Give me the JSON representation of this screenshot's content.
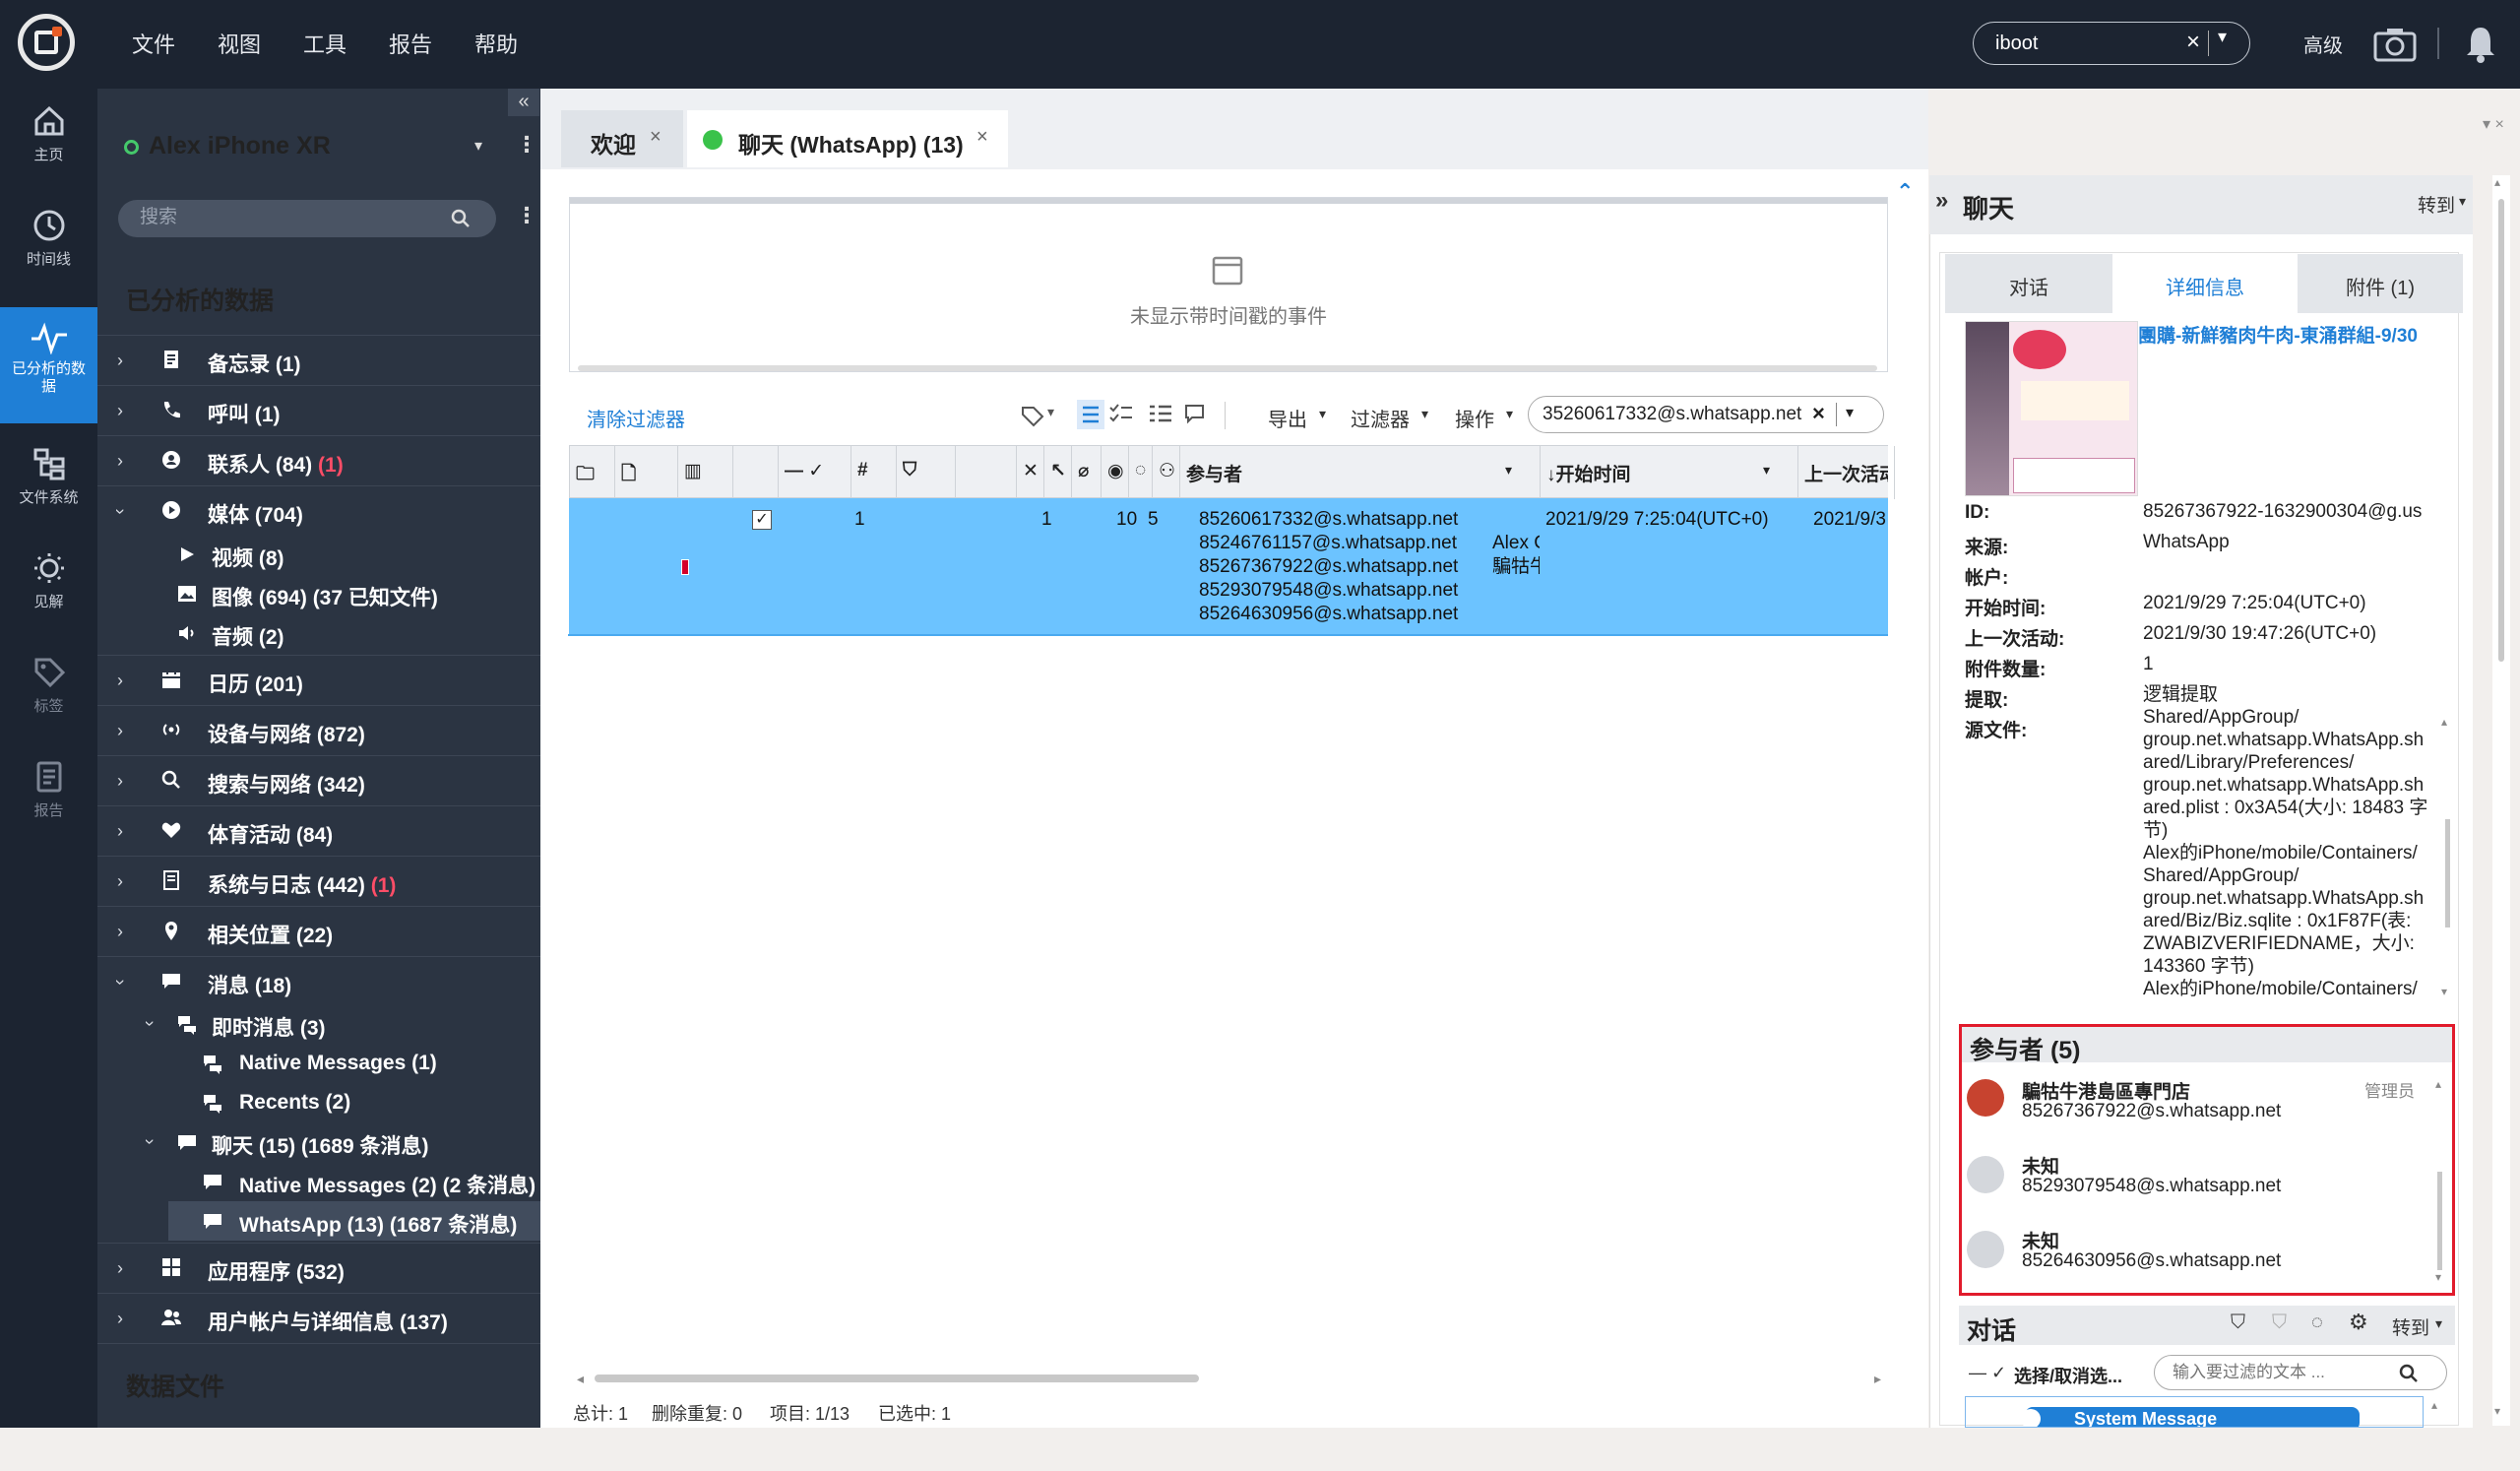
{
  "menu": [
    "文件",
    "视图",
    "工具",
    "报告",
    "帮助"
  ],
  "search": {
    "value": "iboot",
    "advanced": "高级"
  },
  "rail": [
    {
      "label": "主页",
      "icon": "home-icon"
    },
    {
      "label": "时间线",
      "icon": "clock-icon"
    },
    {
      "label": "已分析的数据",
      "icon": "pulse-icon"
    },
    {
      "label": "文件系统",
      "icon": "folder-tree-icon"
    },
    {
      "label": "见解",
      "icon": "lightbulb-icon"
    },
    {
      "label": "标签",
      "icon": "tag-icon"
    },
    {
      "label": "报告",
      "icon": "report-icon"
    }
  ],
  "panel": {
    "device": "Alex iPhone XR",
    "filter_placeholder": "搜索",
    "section_title": "已分析的数据",
    "data_files": "数据文件",
    "tree": [
      {
        "label": "备忘录 (1)",
        "icon": "notes-icon"
      },
      {
        "label": "呼叫 (1)",
        "icon": "phone-icon"
      },
      {
        "label": "联系人 (84)",
        "badge": "(1)",
        "icon": "contact-icon"
      },
      {
        "label": "媒体 (704)",
        "icon": "media-icon"
      },
      {
        "label": "视频 (8)",
        "icon": "video-icon"
      },
      {
        "label": "图像 (694) (37 已知文件)",
        "icon": "image-icon"
      },
      {
        "label": "音频 (2)",
        "icon": "audio-icon"
      },
      {
        "label": "日历 (201)",
        "icon": "calendar-icon"
      },
      {
        "label": "设备与网络 (872)",
        "icon": "wireless-icon"
      },
      {
        "label": "搜索与网络 (342)",
        "icon": "search-icon"
      },
      {
        "label": "体育活动 (84)",
        "icon": "heart-icon"
      },
      {
        "label": "系统与日志 (442)",
        "badge": "(1)",
        "icon": "log-icon"
      },
      {
        "label": "相关位置 (22)",
        "icon": "location-icon"
      },
      {
        "label": "消息 (18)",
        "icon": "message-icon"
      },
      {
        "label": "即时消息 (3)",
        "icon": "chat-icon"
      },
      {
        "label": "Native Messages (1)",
        "icon": "chat-icon"
      },
      {
        "label": "Recents (2)",
        "icon": "chat-icon"
      },
      {
        "label": "聊天 (15) (1689 条消息)",
        "icon": "message-icon"
      },
      {
        "label": "Native Messages (2) (2 条消息)",
        "icon": "message-icon"
      },
      {
        "label": "WhatsApp (13) (1687 条消息)",
        "icon": "message-icon"
      },
      {
        "label": "应用程序 (532)",
        "icon": "apps-icon"
      },
      {
        "label": "用户帐户与详细信息 (137)",
        "icon": "users-icon"
      }
    ]
  },
  "tabs": [
    {
      "label": "欢迎"
    },
    {
      "label": "聊天 (WhatsApp) (13)"
    }
  ],
  "timeline_empty": "未显示带时间戳的事件",
  "toolbar": {
    "clear_filter": "清除过滤器",
    "export": "导出",
    "filter": "过滤器",
    "actions": "操作",
    "participant_filter": "35260617332@s.whatsapp.net"
  },
  "grid": {
    "headers": {
      "number": "#",
      "participants": "参与者",
      "start_time": "开始时间",
      "last_activity": "上一次活动"
    },
    "row": {
      "number": "1",
      "attachments": "1",
      "messages": "10",
      "participants_count": "5",
      "participants": [
        "85260617332@s.whatsapp.net",
        "85246761157@s.whatsapp.net",
        "85267367922@s.whatsapp.net",
        "85293079548@s.whatsapp.net",
        "85264630956@s.whatsapp.net"
      ],
      "names": [
        "Alex C",
        "騙牯牛"
      ],
      "start_time": "2021/9/29 7:25:04(UTC+0)",
      "last_activity": "2021/9/3"
    }
  },
  "status": {
    "total": "总计: 1",
    "dedup": "删除重复: 0",
    "items": "项目: 1/13",
    "selected": "已选中: 1"
  },
  "right": {
    "title": "聊天",
    "goto": "转到",
    "tabs": [
      "对话",
      "详细信息",
      "附件 (1)"
    ],
    "chat_name": "團購-新鮮豬肉牛肉-東涌群組-9/30",
    "details": [
      {
        "k": "ID:",
        "v": "85267367922-1632900304@g.us"
      },
      {
        "k": "来源:",
        "v": "WhatsApp"
      },
      {
        "k": "帐户:",
        "v": ""
      },
      {
        "k": "开始时间:",
        "v": "2021/9/29 7:25:04(UTC+0)"
      },
      {
        "k": "上一次活动:",
        "v": "2021/9/30 19:47:26(UTC+0)"
      },
      {
        "k": "附件数量:",
        "v": "1"
      },
      {
        "k": "提取:",
        "v": "逻辑提取"
      },
      {
        "k": "源文件:",
        "v": ""
      }
    ],
    "source_lines": [
      "Shared/AppGroup/",
      "group.net.whatsapp.WhatsApp.sh",
      "ared/Library/Preferences/",
      "group.net.whatsapp.WhatsApp.sh",
      "ared.plist : 0x3A54(大小: 18483 字",
      "节)",
      "Alex的iPhone/mobile/Containers/",
      "Shared/AppGroup/",
      "group.net.whatsapp.WhatsApp.sh",
      "ared/Biz/Biz.sqlite : 0x1F87F(表:",
      "ZWABIZVERIFIEDNAME，大小:",
      "143360 字节)",
      "Alex的iPhone/mobile/Containers/"
    ],
    "participants_title": "参与者 (5)",
    "participants": [
      {
        "name": "騙牯牛港島區專門店",
        "id": "85267367922@s.whatsapp.net",
        "role": "管理员"
      },
      {
        "name": "未知",
        "id": "85293079548@s.whatsapp.net",
        "role": ""
      },
      {
        "name": "未知",
        "id": "85264630956@s.whatsapp.net",
        "role": ""
      }
    ],
    "conversation_title": "对话",
    "conversation_goto": "转到",
    "select_toggle": "选择/取消选...",
    "conv_filter_placeholder": "输入要过滤的文本 ...",
    "system_message": "System Message"
  }
}
